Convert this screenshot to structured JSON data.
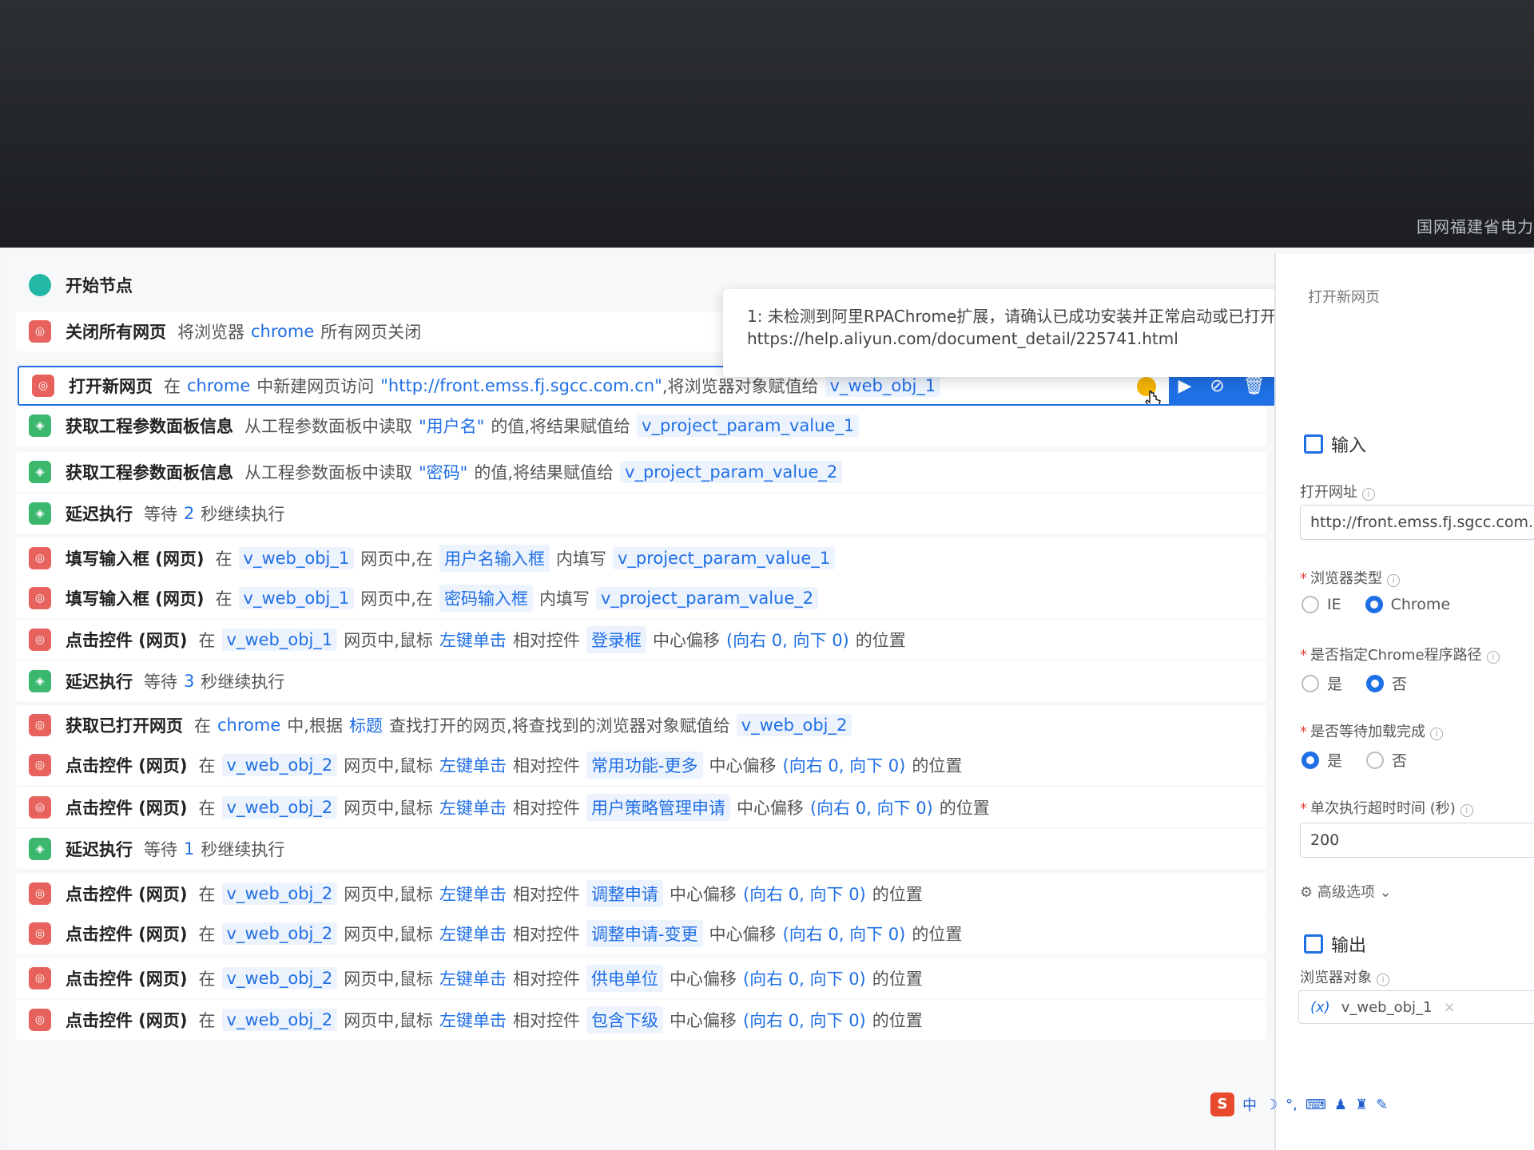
{
  "window": {
    "company": "国网福建省电力"
  },
  "tooltip": {
    "line1": "1: 未检测到阿里RPAChrome扩展，请确认已成功安装并正常启动或已打开目标页面,",
    "line2": "https://help.aliyun.com/document_detail/225741.html"
  },
  "flow": {
    "start": "开始节点",
    "rows": [
      {
        "title": "关闭所有网页",
        "t1": "将浏览器",
        "h1": "chrome",
        "t2": "所有网页关闭"
      },
      {
        "title": "打开新网页",
        "t1": "在",
        "h1": "chrome",
        "t2": "中新建网页访问",
        "h2": "\"http://front.emss.fj.sgcc.com.cn\"",
        "t3": ",将浏览器对象赋值给",
        "c1": "v_web_obj_1"
      },
      {
        "title": "获取工程参数面板信息",
        "t1": "从工程参数面板中读取",
        "h1": "\"用户名\"",
        "t2": "的值,将结果赋值给",
        "c1": "v_project_param_value_1"
      },
      {
        "title": "获取工程参数面板信息",
        "t1": "从工程参数面板中读取",
        "h1": "\"密码\"",
        "t2": "的值,将结果赋值给",
        "c1": "v_project_param_value_2"
      },
      {
        "title": "延迟执行",
        "t1": "等待",
        "h1": "2",
        "t2": "秒继续执行"
      },
      {
        "title": "填写输入框 (网页)",
        "t1": "在",
        "c1": "v_web_obj_1",
        "t2": "网页中,在",
        "c2": "用户名输入框",
        "t3": "内填写",
        "c3": "v_project_param_value_1"
      },
      {
        "title": "填写输入框 (网页)",
        "t1": "在",
        "c1": "v_web_obj_1",
        "t2": "网页中,在",
        "c2": "密码输入框",
        "t3": "内填写",
        "c3": "v_project_param_value_2"
      },
      {
        "title": "点击控件 (网页)",
        "t1": "在",
        "c1": "v_web_obj_1",
        "t2": "网页中,鼠标",
        "h1": "左键单击",
        "t3": "相对控件",
        "c2": "登录框",
        "t4": "中心偏移",
        "h2": "(向右 0, 向下 0)",
        "t5": "的位置"
      },
      {
        "title": "延迟执行",
        "t1": "等待",
        "h1": "3",
        "t2": "秒继续执行"
      },
      {
        "title": "获取已打开网页",
        "t1": "在",
        "h1": "chrome",
        "t2": "中,根据",
        "h2": "标题",
        "t3": "查找打开的网页,将查找到的浏览器对象赋值给",
        "c1": "v_web_obj_2"
      },
      {
        "title": "点击控件 (网页)",
        "t1": "在",
        "c1": "v_web_obj_2",
        "t2": "网页中,鼠标",
        "h1": "左键单击",
        "t3": "相对控件",
        "c2": "常用功能-更多",
        "t4": "中心偏移",
        "h2": "(向右 0, 向下 0)",
        "t5": "的位置"
      },
      {
        "title": "点击控件 (网页)",
        "t1": "在",
        "c1": "v_web_obj_2",
        "t2": "网页中,鼠标",
        "h1": "左键单击",
        "t3": "相对控件",
        "c2": "用户策略管理申请",
        "t4": "中心偏移",
        "h2": "(向右 0, 向下 0)",
        "t5": "的位置"
      },
      {
        "title": "延迟执行",
        "t1": "等待",
        "h1": "1",
        "t2": "秒继续执行"
      },
      {
        "title": "点击控件 (网页)",
        "t1": "在",
        "c1": "v_web_obj_2",
        "t2": "网页中,鼠标",
        "h1": "左键单击",
        "t3": "相对控件",
        "c2": "调整申请",
        "t4": "中心偏移",
        "h2": "(向右 0, 向下 0)",
        "t5": "的位置"
      },
      {
        "title": "点击控件 (网页)",
        "t1": "在",
        "c1": "v_web_obj_2",
        "t2": "网页中,鼠标",
        "h1": "左键单击",
        "t3": "相对控件",
        "c2": "调整申请-变更",
        "t4": "中心偏移",
        "h2": "(向右 0, 向下 0)",
        "t5": "的位置"
      },
      {
        "title": "点击控件 (网页)",
        "t1": "在",
        "c1": "v_web_obj_2",
        "t2": "网页中,鼠标",
        "h1": "左键单击",
        "t3": "相对控件",
        "c2": "供电单位",
        "t4": "中心偏移",
        "h2": "(向右 0, 向下 0)",
        "t5": "的位置"
      },
      {
        "title": "点击控件 (网页)",
        "t1": "在",
        "c1": "v_web_obj_2",
        "t2": "网页中,鼠标",
        "h1": "左键单击",
        "t3": "相对控件",
        "c2": "包含下级",
        "t4": "中心偏移",
        "h2": "(向右 0, 向下 0)",
        "t5": "的位置"
      }
    ]
  },
  "panel": {
    "header": "打开新网页",
    "input_title": "输入",
    "url_label": "打开网址",
    "url_value": "http://front.emss.fj.sgcc.com.cn",
    "browser_label": "浏览器类型",
    "browser_opt1": "IE",
    "browser_opt2": "Chrome",
    "path_label": "是否指定Chrome程序路径",
    "path_yes": "是",
    "path_no": "否",
    "wait_label": "是否等待加载完成",
    "wait_yes": "是",
    "wait_no": "否",
    "timeout_label": "单次执行超时时间 (秒)",
    "timeout_value": "200",
    "advanced": "高级选项",
    "output_title": "输出",
    "output_label": "浏览器对象",
    "output_value": "v_web_obj_1",
    "var_symbol": "(x)"
  },
  "ime": {
    "logo": "S",
    "lang": "中"
  }
}
